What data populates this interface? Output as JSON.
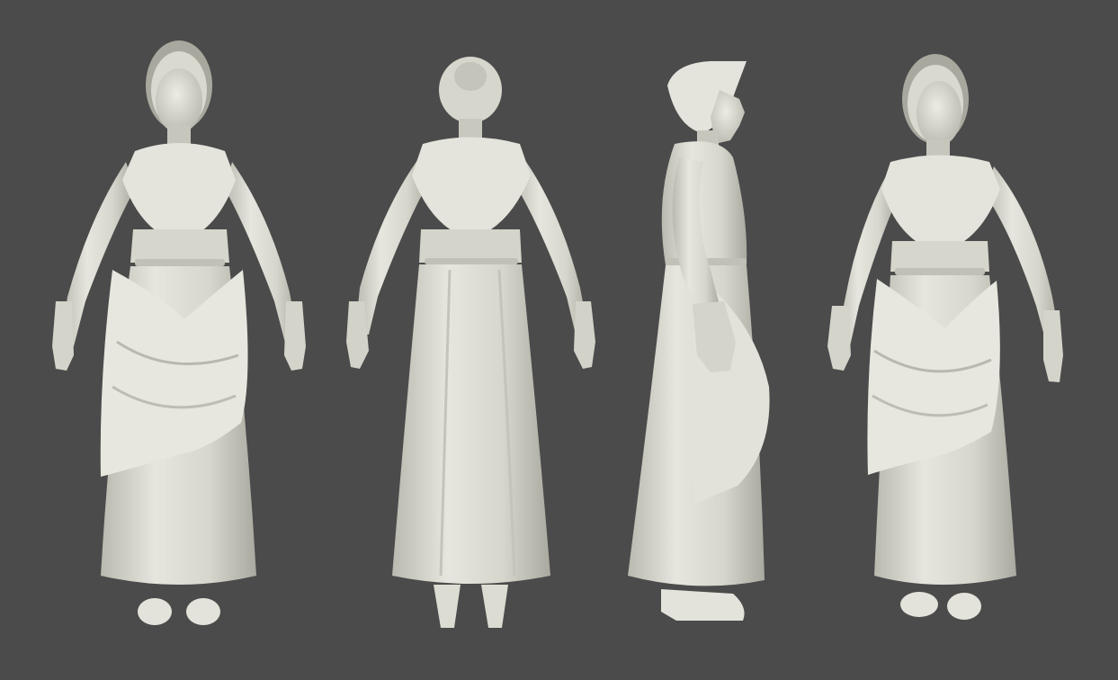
{
  "scene": {
    "background_color": "#4b4b4b",
    "model_color": "#dcdcd2",
    "views": [
      {
        "id": "front",
        "label": ""
      },
      {
        "id": "back",
        "label": ""
      },
      {
        "id": "side",
        "label": ""
      },
      {
        "id": "three-quarter",
        "label": ""
      }
    ]
  }
}
